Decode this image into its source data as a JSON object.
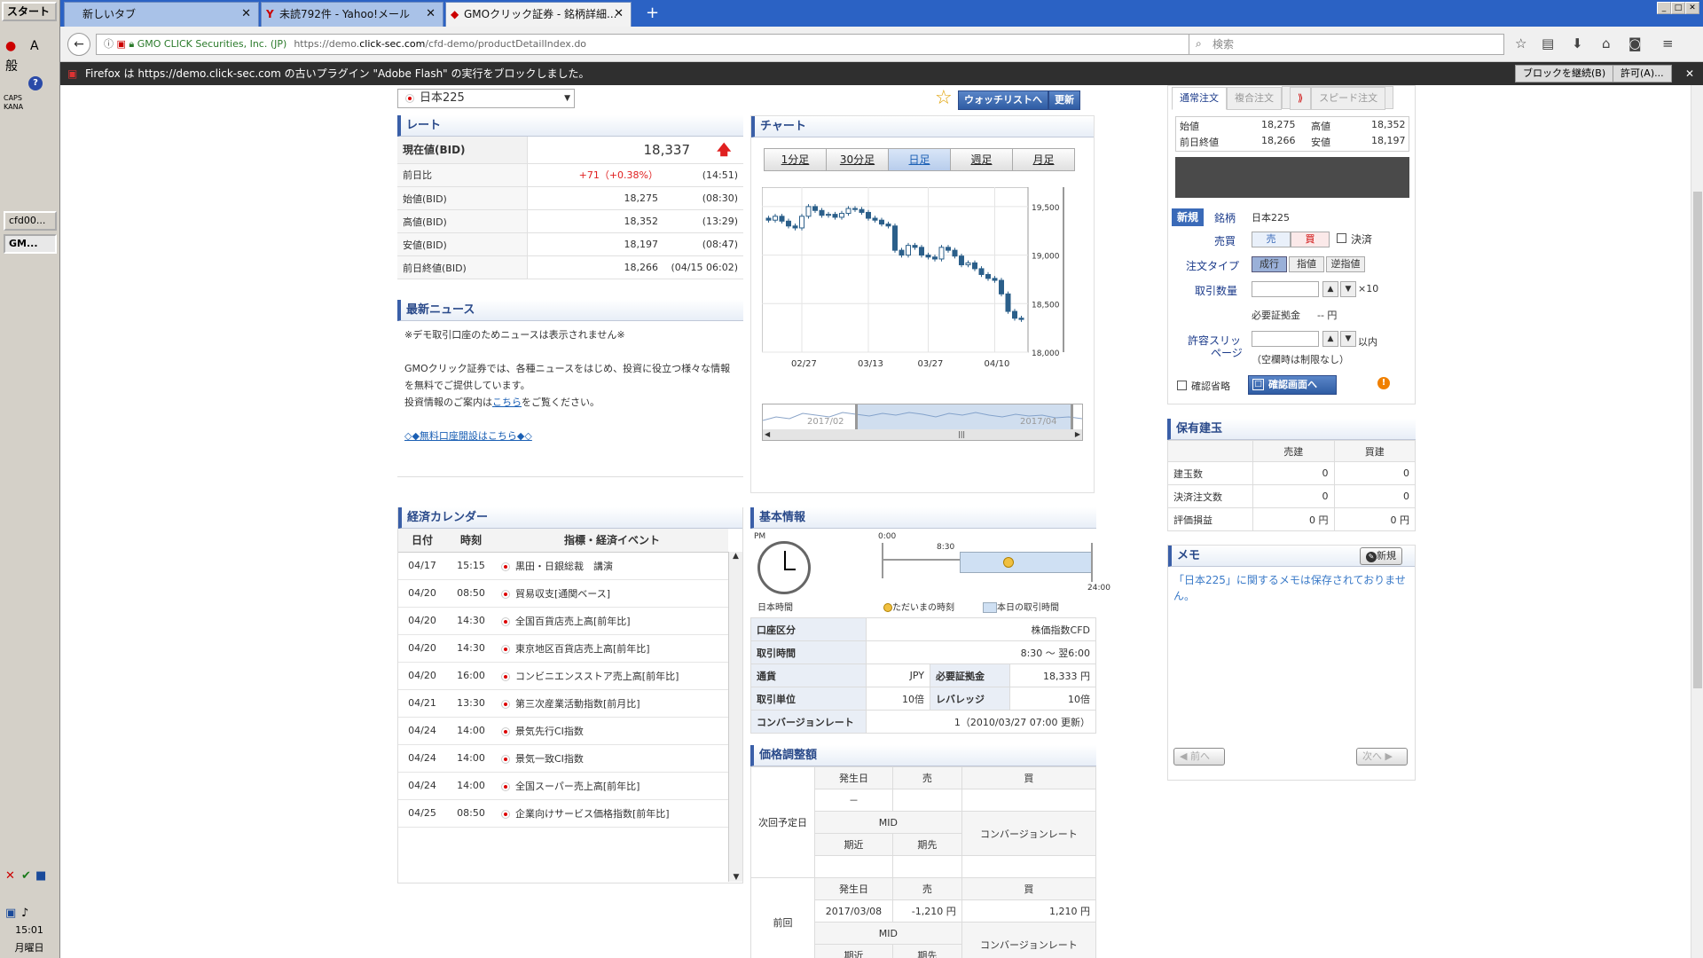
{
  "taskbar": {
    "start": "スタート",
    "caps": "CAPS",
    "kana": "KANA",
    "ime_char1": "A",
    "ime_char2": "般",
    "tasks": [
      "cfd00...",
      "GM..."
    ],
    "clock_time": "15:01",
    "clock_day": "月曜日"
  },
  "tabs": [
    {
      "label": "新しいタブ"
    },
    {
      "label": "未読792件 - Yahoo!メール"
    },
    {
      "label": "GMOクリック証券 - 銘柄詳細..."
    }
  ],
  "nav": {
    "site_identity": "GMO CLICK Securities, Inc. (JP)",
    "url_prefix": "https://demo.",
    "url_domain": "click-sec.com",
    "url_path": "/cfd-demo/productDetailIndex.do",
    "search_placeholder": "検索"
  },
  "flash": {
    "message": "Firefox は https://demo.click-sec.com の古いプラグイン \"Adobe Flash\" の実行をブロックしました。",
    "continue_btn": "ブロックを継続(B)",
    "allow_btn": "許可(A)..."
  },
  "product": {
    "name": "日本225",
    "watchlist_btn": "ウォッチリストへ",
    "refresh_btn": "更新"
  },
  "rate": {
    "title": "レート",
    "current_label": "現在値(BID)",
    "current_value": "18,337",
    "rows": [
      {
        "label": "前日比",
        "value": "+71（+0.38%）",
        "time": "(14:51)"
      },
      {
        "label": "始値(BID)",
        "value": "18,275",
        "time": "(08:30)"
      },
      {
        "label": "高値(BID)",
        "value": "18,352",
        "time": "(13:29)"
      },
      {
        "label": "安値(BID)",
        "value": "18,197",
        "time": "(08:47)"
      },
      {
        "label": "前日終値(BID)",
        "value": "18,266",
        "time": "(04/15 06:02)"
      }
    ]
  },
  "news": {
    "title": "最新ニュース",
    "line1": "※デモ取引口座のためニュースは表示されません※",
    "line2": "GMOクリック証券では、各種ニュースをはじめ、投資に役立つ様々な情報",
    "line3": "を無料でご提供しています。",
    "line4a": "投資情報のご案内は",
    "line4link": "こちら",
    "line4b": "をご覧ください。",
    "link2": "◇◆無料口座開設はこちら◆◇"
  },
  "calendar": {
    "title": "経済カレンダー",
    "headers": [
      "日付",
      "時刻",
      "指標・経済イベント"
    ],
    "rows": [
      {
        "date": "04/17",
        "time": "15:15",
        "event": "黒田・日銀総裁　講演"
      },
      {
        "date": "04/20",
        "time": "08:50",
        "event": "貿易収支[通関ベース]"
      },
      {
        "date": "04/20",
        "time": "14:30",
        "event": "全国百貨店売上高[前年比]"
      },
      {
        "date": "04/20",
        "time": "14:30",
        "event": "東京地区百貨店売上高[前年比]"
      },
      {
        "date": "04/20",
        "time": "16:00",
        "event": "コンビニエンスストア売上高[前年比]"
      },
      {
        "date": "04/21",
        "time": "13:30",
        "event": "第三次産業活動指数[前月比]"
      },
      {
        "date": "04/24",
        "time": "14:00",
        "event": "景気先行CI指数"
      },
      {
        "date": "04/24",
        "time": "14:00",
        "event": "景気一致CI指数"
      },
      {
        "date": "04/24",
        "time": "14:00",
        "event": "全国スーパー売上高[前年比]"
      },
      {
        "date": "04/25",
        "time": "08:50",
        "event": "企業向けサービス価格指数[前年比]"
      }
    ]
  },
  "chart": {
    "title": "チャート",
    "periods": [
      "1分足",
      "30分足",
      "日足",
      "週足",
      "月足"
    ],
    "selected": "日足",
    "y_ticks": [
      "19,500",
      "19,000",
      "18,500",
      "18,000"
    ],
    "x_ticks": [
      "02/27",
      "03/13",
      "03/27",
      "04/10"
    ],
    "nav_labels": [
      "2017/02",
      "2017/04"
    ]
  },
  "chart_data": {
    "type": "candlestick",
    "x": [
      "02/20",
      "02/21",
      "02/22",
      "02/23",
      "02/24",
      "02/27",
      "02/28",
      "03/01",
      "03/02",
      "03/03",
      "03/06",
      "03/07",
      "03/08",
      "03/09",
      "03/10",
      "03/13",
      "03/14",
      "03/15",
      "03/16",
      "03/17",
      "03/21",
      "03/22",
      "03/23",
      "03/24",
      "03/27",
      "03/28",
      "03/29",
      "03/30",
      "03/31",
      "04/03",
      "04/04",
      "04/05",
      "04/06",
      "04/07",
      "04/10",
      "04/11",
      "04/12",
      "04/13",
      "04/14"
    ],
    "open": [
      19380,
      19360,
      19400,
      19350,
      19300,
      19280,
      19400,
      19500,
      19460,
      19410,
      19420,
      19390,
      19430,
      19480,
      19470,
      19440,
      19380,
      19360,
      19320,
      19300,
      19050,
      19000,
      19100,
      19080,
      19000,
      18980,
      18960,
      19080,
      19050,
      18990,
      18900,
      18920,
      18860,
      18800,
      18760,
      18740,
      18600,
      18420,
      18350
    ],
    "close": [
      19360,
      19400,
      19350,
      19300,
      19280,
      19400,
      19500,
      19460,
      19410,
      19420,
      19390,
      19430,
      19480,
      19470,
      19440,
      19380,
      19360,
      19320,
      19300,
      19050,
      19000,
      19100,
      19080,
      19000,
      18980,
      18960,
      19080,
      19050,
      18990,
      18900,
      18920,
      18860,
      18800,
      18760,
      18740,
      18600,
      18420,
      18350,
      18337
    ],
    "y_range": [
      18000,
      19700
    ]
  },
  "basic": {
    "title": "基本情報",
    "pm": "PM",
    "clock_label": "日本時間",
    "t_start": "0:00",
    "t_open": "8:30",
    "t_end": "24:00",
    "legend_now": "ただいまの時刻",
    "legend_hours": "本日の取引時間",
    "rows": {
      "kouza_label": "口座区分",
      "kouza_value": "株価指数CFD",
      "time_label": "取引時間",
      "time_value": "8:30 ～ 翌6:00",
      "currency_label": "通貨",
      "currency_value": "JPY",
      "margin_label": "必要証拠金",
      "margin_value": "18,333 円",
      "unit_label": "取引単位",
      "unit_value": "10倍",
      "leverage_label": "レバレッジ",
      "leverage_value": "10倍",
      "conv_label": "コンバージョンレート",
      "conv_value": "1（2010/03/27 07:00 更新）"
    }
  },
  "adjust": {
    "title": "価格調整額",
    "next_label": "次回予定日",
    "prev_label": "前回",
    "h_date": "発生日",
    "h_sell": "売",
    "h_buy": "買",
    "mid": "MID",
    "h_near": "期近",
    "h_far": "期先",
    "h_conv": "コンバージョンレート",
    "next_date": "－",
    "prev_date": "2017/03/08",
    "prev_sell": "-1,210 円",
    "prev_buy": "1,210 円"
  },
  "order": {
    "tabs": [
      "通常注文",
      "複合注文",
      "スピード注文"
    ],
    "open_label": "始値",
    "open_value": "18,275",
    "high_label": "高値",
    "high_value": "18,352",
    "prevclose_label": "前日終値",
    "prevclose_value": "18,266",
    "low_label": "安値",
    "low_value": "18,197",
    "new_label": "新規",
    "symbol_label": "銘柄",
    "symbol_value": "日本225",
    "side_label": "売買",
    "sell": "売",
    "buy": "買",
    "settle": "決済",
    "type_label": "注文タイプ",
    "types": [
      "成行",
      "指値",
      "逆指値"
    ],
    "qty_label": "取引数量",
    "qty_mult": "×10",
    "margin_label": "必要証拠金",
    "margin_value": "-- 円",
    "slip_label1": "許容スリッ",
    "slip_label2": "ページ",
    "slip_unit": "以内",
    "slip_note": "（空欄時は制限なし）",
    "confirm_skip": "確認省略",
    "confirm_btn": "確認画面へ"
  },
  "position": {
    "title": "保有建玉",
    "headers": [
      "売建",
      "買建"
    ],
    "rows": [
      {
        "label": "建玉数",
        "sell": "0",
        "buy": "0"
      },
      {
        "label": "決済注文数",
        "sell": "0",
        "buy": "0"
      },
      {
        "label": "評価損益",
        "sell": "0 円",
        "buy": "0 円"
      }
    ]
  },
  "memo": {
    "title": "メモ",
    "new_btn": "新規",
    "text": "「日本225」に関するメモは保存されておりません。",
    "prev_btn": "前へ",
    "next_btn": "次へ"
  },
  "colors": {
    "accent": "#2a4a8a",
    "up": "#e02020",
    "candle": "#2b5f8a",
    "tabbar": "#2b62c4"
  }
}
